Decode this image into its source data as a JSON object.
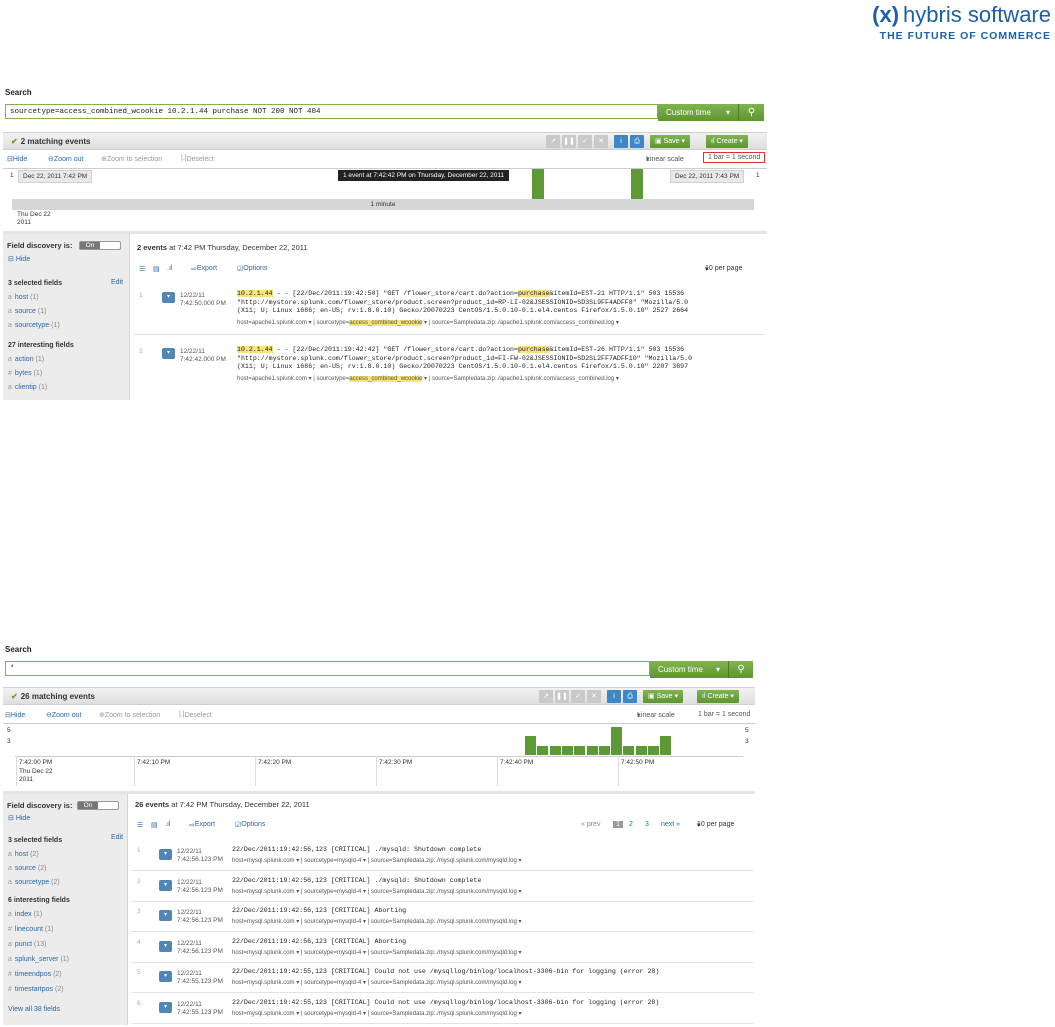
{
  "logo": {
    "glyph": "(x)",
    "name": "hybris software",
    "tagline": "THE FUTURE OF COMMERCE"
  },
  "panel1": {
    "search_title": "Search",
    "query": "sourcetype=access_combined_wcookie 10.2.1.44 purchase NOT 200 NOT 404",
    "time_button": "Custom time",
    "matching": "2 matching events",
    "save": "Save",
    "create": "Create",
    "tl_hide": "Hide",
    "tl_zoom_out": "Zoom out",
    "tl_zoom_sel": "Zoom to selection",
    "tl_deselect": "Deselect",
    "linear_scale": "Linear scale",
    "bar_scale": "1 bar = 1 second",
    "y_top": "1",
    "y_top_right": "1",
    "tooltip": "1 event at 7:42:42 PM on Thursday, December 22, 2011",
    "date_left": "Dec 22, 2011 7:42 PM",
    "date_right": "Dec 22, 2011 7:43 PM",
    "span_label": "1 minute",
    "x_day": "Thu Dec 22",
    "x_year": "2011",
    "fd_label": "Field discovery is:",
    "fd_toggle": "On",
    "sb_hide": "Hide",
    "selected_head": "3 selected fields",
    "edit": "Edit",
    "selected_fields": [
      {
        "name": "host",
        "count": "(1)"
      },
      {
        "name": "source",
        "count": "(1)"
      },
      {
        "name": "sourcetype",
        "count": "(1)"
      }
    ],
    "interesting_head": "27 interesting fields",
    "interesting_fields": [
      {
        "name": "action",
        "count": "(1)"
      },
      {
        "name": "bytes",
        "count": "(1)"
      },
      {
        "name": "clientip",
        "count": "(1)"
      }
    ],
    "events_count": "2 events",
    "events_when": "at 7:42 PM Thursday, December 22, 2011",
    "export": "Export",
    "options": "Options",
    "per_page": "10 per page",
    "events": [
      {
        "num": "1",
        "date": "12/22/11",
        "time": "7:42:50.000 PM",
        "ip": "10.2.1.44",
        "l1a": " - - [22/Dec/2011:19:42:50] \"GET /flower_store/cart.do?action=",
        "l1b": "purchase",
        "l1c": "&itemId=EST-21 HTTP/1.1\" 503 15536",
        "l2": "\"http://mystore.splunk.com/flower_store/product.screen?product_id=RP-LI-02&JSESSIONID=SD3SL9FF4ADFF8\" \"Mozilla/5.0",
        "l3": "(X11; U; Linux i686; en-US; rv:1.8.0.10) Gecko/20070223 CentOS/1.5.0.10-0.1.el4.centos Firefox/1.5.0.10\" 2527 2664",
        "meta_host": "host=apache1.splunk.com",
        "meta_st_prefix": "sourcetype=",
        "meta_st": "access_combined_wcookie",
        "meta_src": "source=Sampledata.zip:./apache1.splunk.com/access_combined.log"
      },
      {
        "num": "2",
        "date": "12/22/11",
        "time": "7:42:42.000 PM",
        "ip": "10.2.1.44",
        "l1a": " - - [22/Dec/2011:19:42:42] \"GET /flower_store/cart.do?action=",
        "l1b": "purchase",
        "l1c": "&itemId=EST-26 HTTP/1.1\" 503 15536",
        "l2": "\"http://mystore.splunk.com/flower_store/product.screen?product_id=FI-FW-02&JSESSIONID=SD2SL2FF7ADFF10\" \"Mozilla/5.0",
        "l3": "(X11; U; Linux i686; en-US; rv:1.8.0.10) Gecko/20070223 CentOS/1.5.0.10-0.1.el4.centos Firefox/1.5.0.10\" 2207 3897",
        "meta_host": "host=apache1.splunk.com",
        "meta_st_prefix": "sourcetype=",
        "meta_st": "access_combined_wcookie",
        "meta_src": "source=Sampledata.zip:./apache1.splunk.com/access_combined.log"
      }
    ]
  },
  "panel2": {
    "search_title": "Search",
    "query": "*",
    "time_button": "Custom time",
    "matching": "26 matching events",
    "save": "Save",
    "create": "Create",
    "tl_hide": "Hide",
    "tl_zoom_out": "Zoom out",
    "tl_zoom_sel": "Zoom to selection",
    "tl_deselect": "Deselect",
    "linear_scale": "Linear scale",
    "bar_scale": "1 bar = 1 second",
    "y_5": "5",
    "y_3": "3",
    "x_ticks": [
      "7:42:00 PM",
      "7:42:10 PM",
      "7:42:20 PM",
      "7:42:30 PM",
      "7:42:40 PM",
      "7:42:50 PM"
    ],
    "x_day": "Thu Dec 22",
    "x_year": "2011",
    "bar_counts": [
      2,
      1,
      1,
      1,
      1,
      1,
      1,
      3,
      1,
      1,
      1,
      2
    ],
    "fd_label": "Field discovery is:",
    "fd_toggle": "On",
    "sb_hide": "Hide",
    "selected_head": "3 selected fields",
    "edit": "Edit",
    "selected_fields": [
      {
        "name": "host",
        "count": "(2)"
      },
      {
        "name": "source",
        "count": "(2)"
      },
      {
        "name": "sourcetype",
        "count": "(2)"
      }
    ],
    "interesting_head": "6 interesting fields",
    "interesting_fields": [
      {
        "name": "index",
        "count": "(1)"
      },
      {
        "name": "linecount",
        "count": "(1)"
      },
      {
        "name": "punct",
        "count": "(13)"
      },
      {
        "name": "splunk_server",
        "count": "(1)"
      },
      {
        "name": "timeendpos",
        "count": "(2)"
      },
      {
        "name": "timestartpos",
        "count": "(2)"
      }
    ],
    "view_all": "View all 38 fields",
    "events_count": "26 events",
    "events_when": "at 7:42 PM Thursday, December 22, 2011",
    "export": "Export",
    "options": "Options",
    "prev": "« prev",
    "pages": [
      "1",
      "2",
      "3"
    ],
    "next": "next »",
    "per_page": "10 per page",
    "events": [
      {
        "num": "1",
        "date": "12/22/11",
        "time": "7:42:56.123 PM",
        "raw": "22/Dec/2011:19:42:56,123 [CRITICAL] ./mysqld: Shutdown complete",
        "host": "host=mysql.splunk.com",
        "st": "sourcetype=mysqld-4",
        "src": "source=Sampledata.zip:./mysql.splunk.com/mysqld.log"
      },
      {
        "num": "2",
        "date": "12/22/11",
        "time": "7:42:56.123 PM",
        "raw": "22/Dec/2011:19:42:56,123 [CRITICAL] ./mysqld: Shutdown complete",
        "host": "host=mysql.splunk.com",
        "st": "sourcetype=mysqld-4",
        "src": "source=Sampledata.zip:./mysql.splunk.com/mysqld.log"
      },
      {
        "num": "3",
        "date": "12/22/11",
        "time": "7:42:56.123 PM",
        "raw": "22/Dec/2011:19:42:56,123 [CRITICAL] Aborting",
        "host": "host=mysql.splunk.com",
        "st": "sourcetype=mysqld-4",
        "src": "source=Sampledata.zip:./mysql.splunk.com/mysqld.log"
      },
      {
        "num": "4",
        "date": "12/22/11",
        "time": "7:42:56.123 PM",
        "raw": "22/Dec/2011:19:42:56,123 [CRITICAL] Aborting",
        "host": "host=mysql.splunk.com",
        "st": "sourcetype=mysqld-4",
        "src": "source=Sampledata.zip:./mysql.splunk.com/mysqld.log"
      },
      {
        "num": "5",
        "date": "12/22/11",
        "time": "7:42:55.123 PM",
        "raw": "22/Dec/2011:19:42:55,123 [CRITICAL] Could not use /mysqllog/binlog/localhost-3306-bin for logging (error 28)",
        "host": "host=mysql.splunk.com",
        "st": "sourcetype=mysqld-4",
        "src": "source=Sampledata.zip:./mysql.splunk.com/mysqld.log"
      },
      {
        "num": "6",
        "date": "12/22/11",
        "time": "7:42:55.123 PM",
        "raw": "22/Dec/2011:19:42:55,123 [CRITICAL] Could not use /mysqllog/binlog/localhost-3306-bin for logging (error 28)",
        "host": "host=mysql.splunk.com",
        "st": "sourcetype=mysqld-4",
        "src": "source=Sampledata.zip:./mysql.splunk.com/mysqld.log"
      }
    ]
  }
}
